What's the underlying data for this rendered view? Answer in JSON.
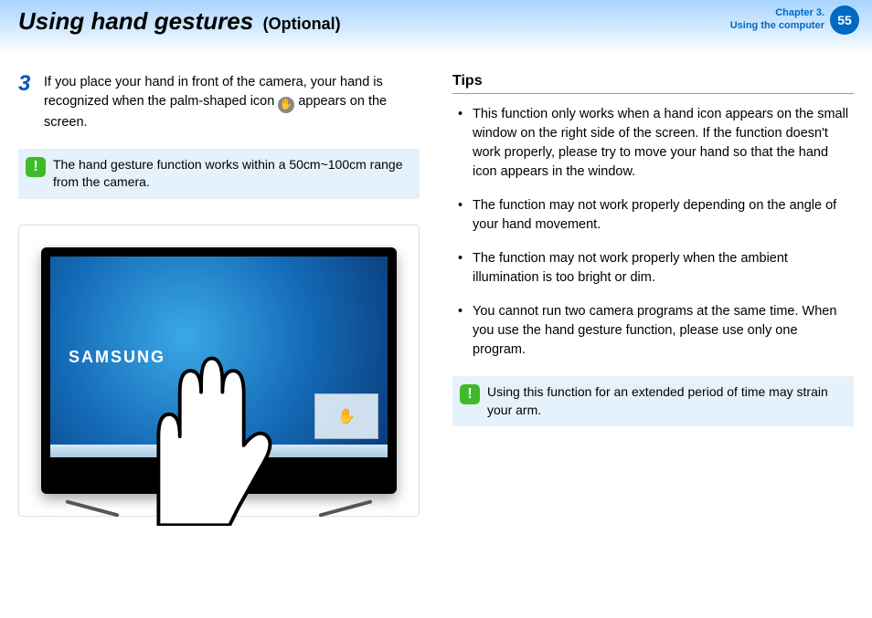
{
  "header": {
    "title_main": "Using hand gestures",
    "title_optional": "(Optional)",
    "chapter_line1": "Chapter 3.",
    "chapter_line2": "Using the computer",
    "page_number": "55"
  },
  "left": {
    "step_number": "3",
    "step_text_before": "If you place your hand in front of the camera, your hand is recognized when the palm-shaped icon ",
    "step_text_after": " appears on the screen.",
    "note_text": "The hand gesture function works within a 50cm~100cm range from the camera.",
    "brand_label": "SAMSUNG",
    "palm_glyph": "✋",
    "overlay_glyph": "✋"
  },
  "right": {
    "tips_heading": "Tips",
    "tips": [
      "This function only works when a hand icon appears on the small window on the right side of the screen. If the function doesn't work properly, please try to move your hand so that the hand icon appears in the window.",
      "The function may not work properly depending on the angle of your hand movement.",
      "The function may not work properly when the ambient illumination is too bright or dim.",
      "You cannot run two camera programs at the same time. When you use the hand gesture function, please use only one program."
    ],
    "note_text": "Using this function for an extended period of time may strain your arm."
  },
  "icons": {
    "alert_glyph": "!"
  }
}
